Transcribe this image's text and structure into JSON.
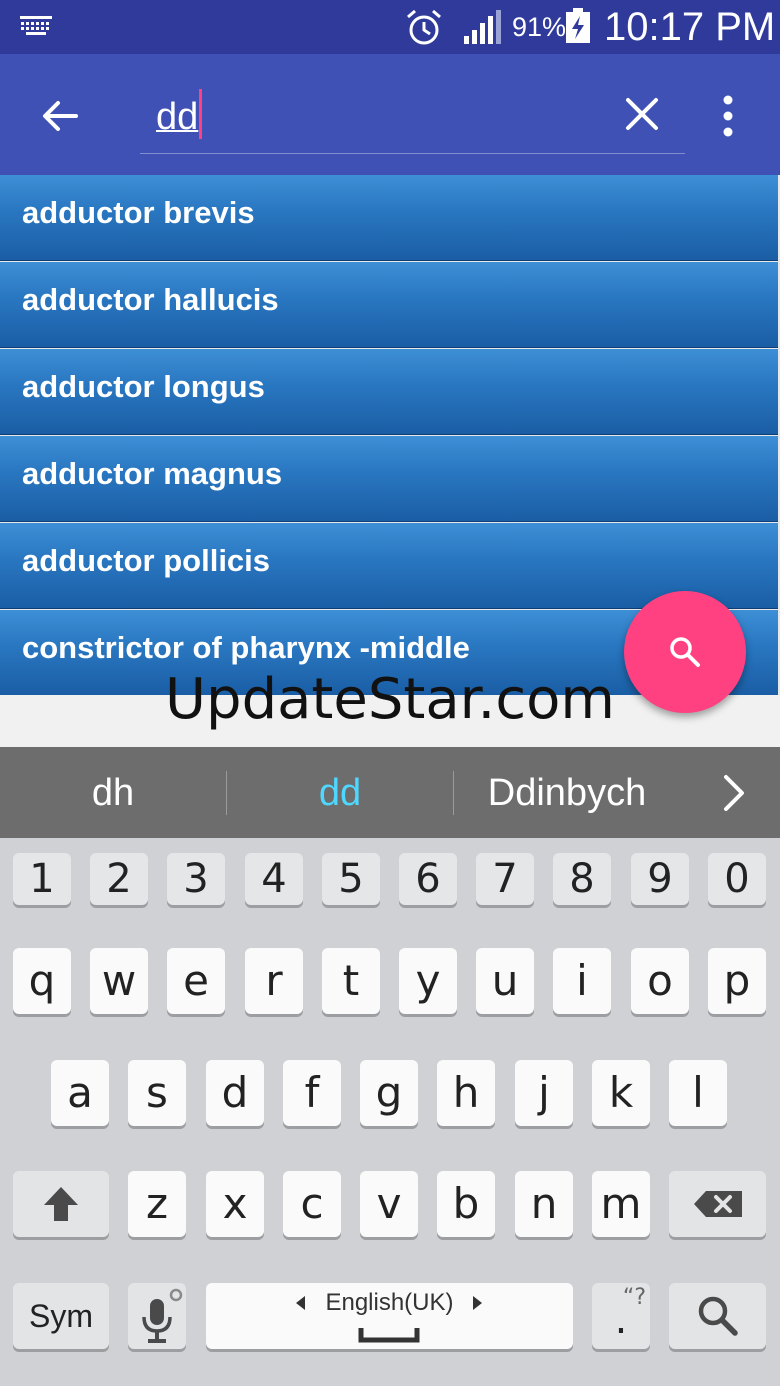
{
  "status_bar": {
    "battery_percent": "91%",
    "time": "10:17 PM",
    "icons": [
      "keyboard-icon",
      "alarm-icon",
      "signal-icon",
      "battery-charging-icon"
    ]
  },
  "search": {
    "query": "dd",
    "icons": [
      "back-arrow-icon",
      "clear-icon",
      "more-vert-icon"
    ]
  },
  "results": [
    "adductor brevis",
    "adductor hallucis",
    "adductor longus",
    "adductor magnus",
    "adductor pollicis",
    "constrictor of pharynx -middle"
  ],
  "watermark": "UpdateStar.com",
  "fab": {
    "icon": "search-icon",
    "color": "#ff4081"
  },
  "suggestions": [
    "dh",
    "dd",
    "Ddinbych"
  ],
  "keyboard": {
    "numbers": [
      "1",
      "2",
      "3",
      "4",
      "5",
      "6",
      "7",
      "8",
      "9",
      "0"
    ],
    "row1": [
      "q",
      "w",
      "e",
      "r",
      "t",
      "y",
      "u",
      "i",
      "o",
      "p"
    ],
    "row2": [
      "a",
      "s",
      "d",
      "f",
      "g",
      "h",
      "j",
      "k",
      "l"
    ],
    "row3": [
      "z",
      "x",
      "c",
      "v",
      "b",
      "n",
      "m"
    ],
    "sym_label": "Sym",
    "space_label": "English(UK)",
    "period_label": ".",
    "period_hint": "“?"
  },
  "colors": {
    "status_bar": "#2f3a9a",
    "app_bar": "#3f51b5",
    "accent": "#ff4081",
    "list_item": "#2a78c2",
    "suggestion_highlight": "#4fd8ff"
  }
}
